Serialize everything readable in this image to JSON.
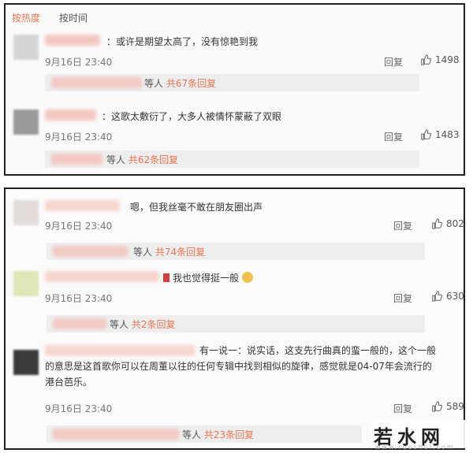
{
  "tabs": {
    "hot": "按热度",
    "time": "按时间"
  },
  "panel1": {
    "comments": [
      {
        "text": "：或许是期望太高了，没有惊艳到我",
        "time": "9月16日 23:40",
        "reply": "回复",
        "likes": "1498",
        "sub_suffix": "等人",
        "sub_link": "共67条回复"
      },
      {
        "text": "：这歌太敷衍了，大多人被情怀蒙蔽了双眼",
        "time": "9月16日 23:40",
        "reply": "回复",
        "likes": "1483",
        "sub_suffix": "等人",
        "sub_link": "共62条回复"
      }
    ]
  },
  "panel2": {
    "comments": [
      {
        "text": "嗯，但我丝毫不敢在朋友圈出声",
        "time": "9月16日 23:40",
        "reply": "回复",
        "likes": "802",
        "sub_suffix": "等人",
        "sub_link": "共74条回复"
      },
      {
        "text": "我也觉得挺一般",
        "time": "9月16日 23:40",
        "reply": "回复",
        "likes": "630",
        "sub_suffix": "等人",
        "sub_link": "共2条回复"
      },
      {
        "text": "有一说一：说实话，这支先行曲真的蛮一般的，这个一般的意思是这首歌你可以在周董以往的任何专辑中找到相似的旋律，感觉就是04-07年会流行的港台芭乐。",
        "time": "9月16日 23:40",
        "reply": "回复",
        "likes": "589",
        "sub_suffix": "等人",
        "sub_link": "共23条回复"
      }
    ]
  },
  "watermark": {
    "main": "若水网",
    "sub": "www.ruoshui.com"
  },
  "colors": {
    "accent": "#eb7350",
    "border": "#222222"
  }
}
